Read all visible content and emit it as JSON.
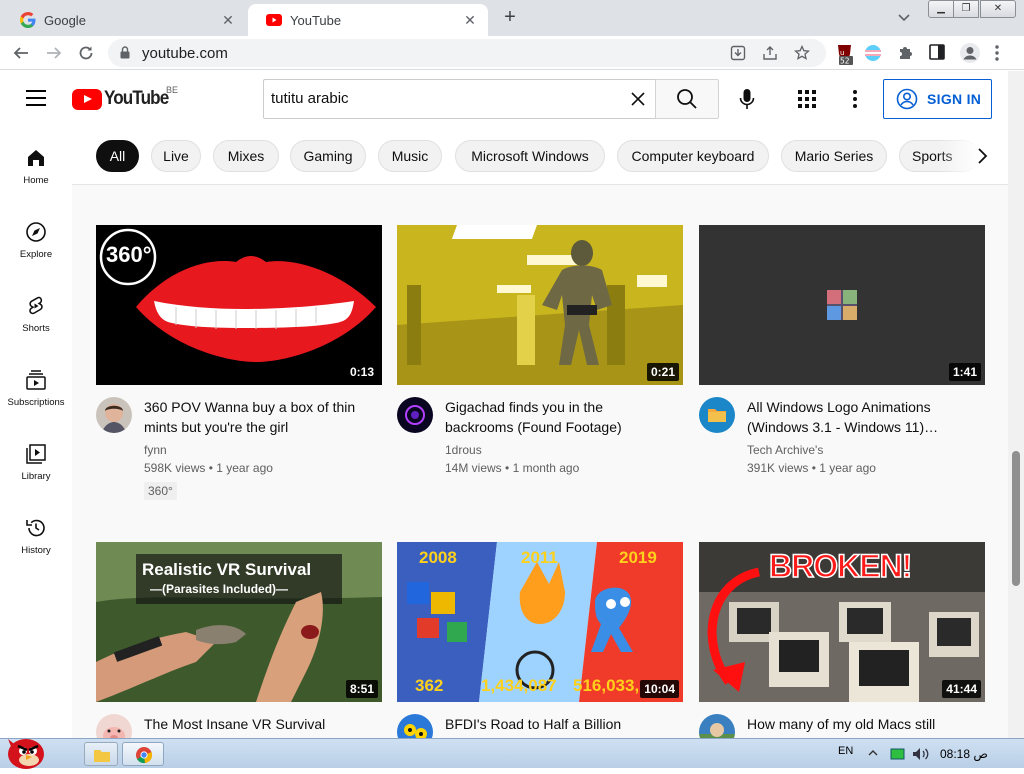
{
  "browser": {
    "tabs": [
      {
        "title": "Google",
        "active": false
      },
      {
        "title": "YouTube",
        "active": true
      }
    ],
    "url": "youtube.com",
    "extension_badge": "52"
  },
  "youtube": {
    "logo_text": "YouTube",
    "country_code": "BE",
    "search_query": "tutitu arabic",
    "signin_label": "SIGN IN",
    "sidebar": [
      {
        "label": "Home"
      },
      {
        "label": "Explore"
      },
      {
        "label": "Shorts"
      },
      {
        "label": "Subscriptions"
      },
      {
        "label": "Library"
      },
      {
        "label": "History"
      }
    ],
    "chips": [
      "All",
      "Live",
      "Mixes",
      "Gaming",
      "Music",
      "Microsoft Windows",
      "Computer keyboard",
      "Mario Series",
      "Sports"
    ],
    "videos": [
      {
        "title": "360 POV Wanna buy a box of thin mints but you're the girl",
        "channel": "fynn",
        "views": "598K views",
        "age": "1 year ago",
        "duration": "0:13",
        "badge": "360°",
        "thumb_text": "360°"
      },
      {
        "title": "Gigachad finds you in the backrooms (Found Footage)",
        "channel": "1drous",
        "views": "14M views",
        "age": "1 month ago",
        "duration": "0:21"
      },
      {
        "title": "All Windows Logo Animations (Windows 3.1 - Windows 11)…",
        "channel": "Tech Archive's",
        "views": "391K views",
        "age": "1 year ago",
        "duration": "1:41"
      },
      {
        "title": "The Most Insane VR Survival",
        "duration": "8:51",
        "thumb_line1": "Realistic VR Survival",
        "thumb_line2": "—(Parasites Included)—"
      },
      {
        "title": "BFDI's Road to Half a Billion",
        "duration": "10:04",
        "thumb_years": [
          "2008",
          "2011",
          "2019"
        ],
        "thumb_counts": [
          "362",
          "1,434,087",
          "516,033,"
        ]
      },
      {
        "title": "How many of my old Macs still",
        "duration": "41:44",
        "thumb_text": "BROKEN!"
      }
    ]
  },
  "taskbar": {
    "language": "EN",
    "clock": "08:18 ص"
  },
  "colors": {
    "youtube_red": "#ff0000",
    "signin_blue": "#065fd4",
    "chip_bg": "#f2f2f2",
    "chip_active": "#0f0f0f"
  }
}
